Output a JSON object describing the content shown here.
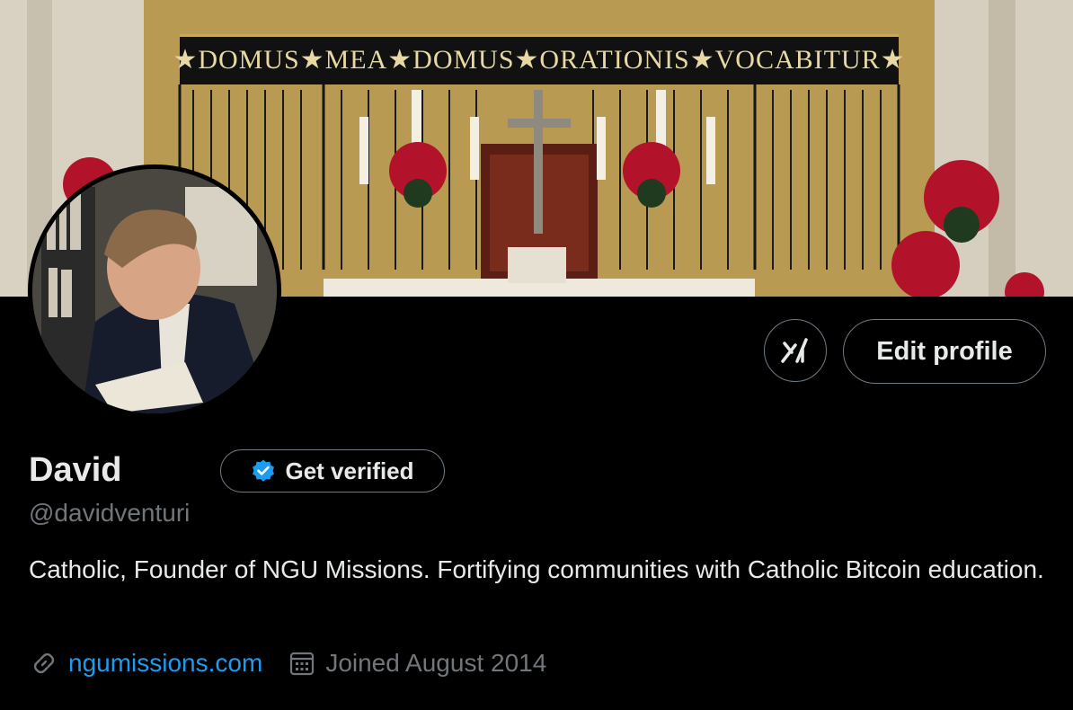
{
  "banner": {
    "inscription": "★DOMUS★MEA★DOMUS★ORATIONIS★VOCABITUR★",
    "icon": "altar-photo"
  },
  "avatar": {
    "icon": "profile-photo"
  },
  "actions": {
    "grok_icon": "grok-icon",
    "edit_profile_label": "Edit profile"
  },
  "profile": {
    "name": "David",
    "verify_label": "Get verified",
    "verify_icon": "verified-badge-icon",
    "handle": "@davidventuri",
    "bio": "Catholic, Founder of NGU Missions. Fortifying communities with Catholic Bitcoin education.",
    "website": "ngumissions.com",
    "joined": "Joined August 2014"
  },
  "colors": {
    "background": "#000000",
    "text_primary": "#e7e9ea",
    "text_secondary": "#71767b",
    "link": "#1d9bf0",
    "verified_badge": "#1d9bf0",
    "border": "#6f7a84"
  }
}
